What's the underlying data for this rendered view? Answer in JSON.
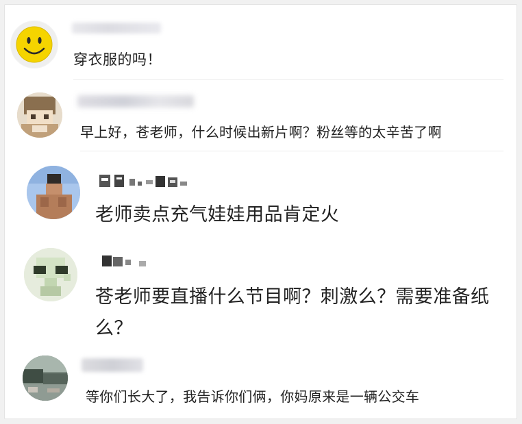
{
  "comments": [
    {
      "text": "穿衣服的吗！",
      "avatar_icon": "smiley-face-icon",
      "username_blurred": true
    },
    {
      "text": "早上好，苍老师，什么时候出新片啊？粉丝等的太辛苦了啊",
      "avatar_icon": "cartoon-avatar-icon",
      "username_blurred": true
    },
    {
      "text": "老师卖点充气娃娃用品肯定火",
      "avatar_icon": "person-avatar-icon",
      "username_blurred": true
    },
    {
      "text": "苍老师要直播什么节目啊？刺激么？需要准备纸么？",
      "avatar_icon": "alien-avatar-icon",
      "username_blurred": true
    },
    {
      "text": "等你们长大了，我告诉你们俩，你妈原来是一辆公交车",
      "avatar_icon": "landscape-avatar-icon",
      "username_blurred": true
    }
  ],
  "colors": {
    "text": "#222222",
    "background": "#f1f1f1",
    "card": "#ffffff",
    "smiley": "#f5d400"
  }
}
